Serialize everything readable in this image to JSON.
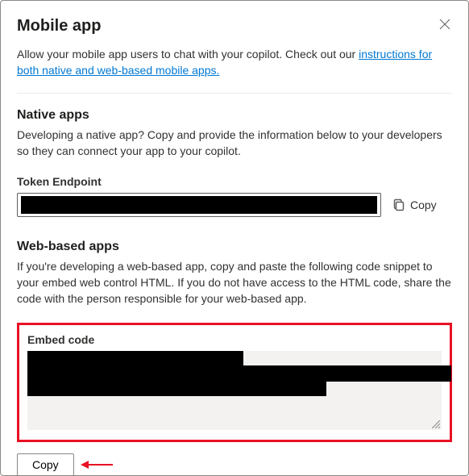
{
  "header": {
    "title": "Mobile app"
  },
  "intro": {
    "text_before_link": "Allow your mobile app users to chat with your copilot. Check out our ",
    "link_text": "instructions for both native and web-based mobile apps."
  },
  "native": {
    "title": "Native apps",
    "desc": "Developing a native app? Copy and provide the information below to your developers so they can connect your app to your copilot.",
    "token_label": "Token Endpoint",
    "token_value": "",
    "copy_label": "Copy"
  },
  "web": {
    "title": "Web-based apps",
    "desc": "If you're developing a web-based app, copy and paste the following code snippet to your embed web control HTML. If you do not have access to the HTML code, share the code with the person responsible for your web-based app.",
    "embed_label": "Embed code",
    "embed_value": "",
    "copy_button": "Copy"
  }
}
